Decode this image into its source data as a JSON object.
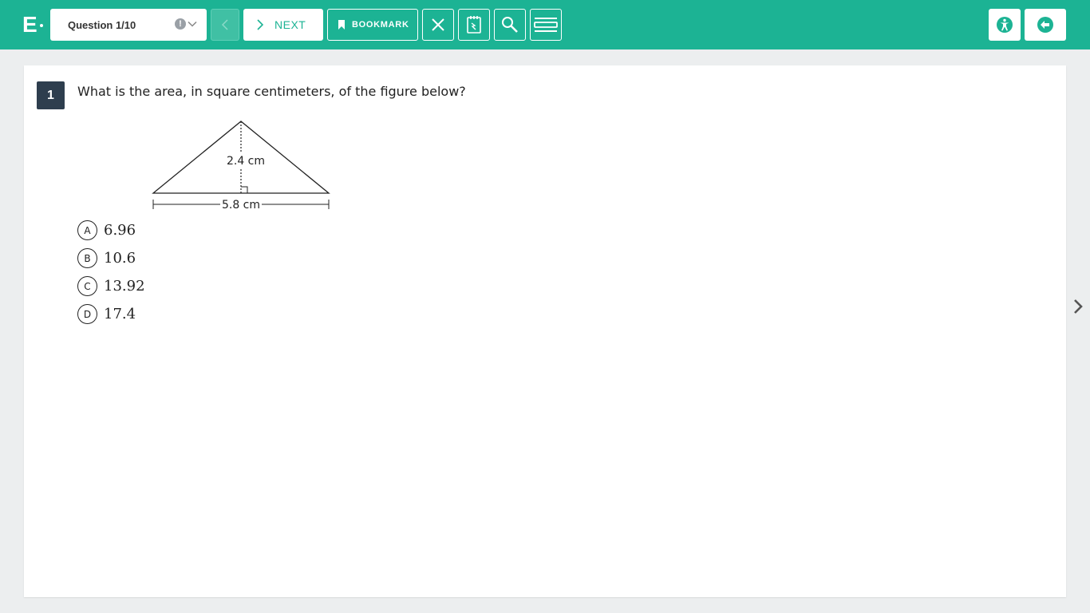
{
  "header": {
    "logo_letter": "E",
    "question_select": "Question 1/10",
    "flag_glyph": "!",
    "next_label": "NEXT",
    "bookmark_label": "BOOKMARK"
  },
  "question": {
    "number": "1",
    "text": "What is the area, in square centimeters, of the figure below?",
    "figure": {
      "height_label": "2.4 cm",
      "base_label": "5.8 cm"
    },
    "choices": [
      {
        "letter": "A",
        "value": "6.96"
      },
      {
        "letter": "B",
        "value": "10.6"
      },
      {
        "letter": "C",
        "value": "13.92"
      },
      {
        "letter": "D",
        "value": "17.4"
      }
    ]
  },
  "colors": {
    "header_bg": "#1cb394",
    "badge_bg": "#2e3e4e",
    "page_bg": "#eceeef"
  }
}
